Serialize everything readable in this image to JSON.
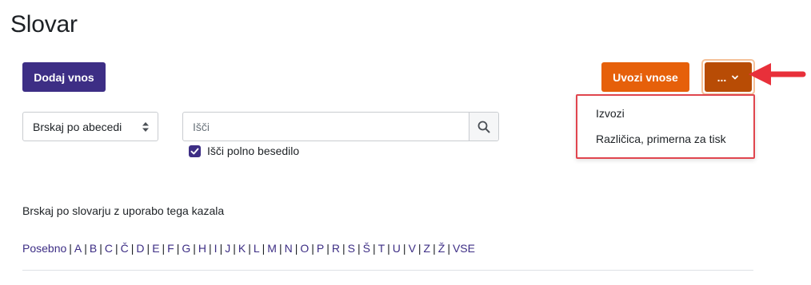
{
  "page": {
    "title": "Slovar"
  },
  "toolbar": {
    "add_label": "Dodaj vnos",
    "import_label": "Uvozi vnose",
    "more_label": "..."
  },
  "more_menu": {
    "items": [
      "Izvozi",
      "Različica, primerna za tisk"
    ]
  },
  "browse_select": {
    "value": "Brskaj po abecedi"
  },
  "search": {
    "placeholder": "Išči",
    "value": ""
  },
  "fulltext": {
    "label": "Išči polno besedilo",
    "checked": true
  },
  "browse": {
    "hint": "Brskaj po slovarju z uporabo tega kazala",
    "letters": [
      "Posebno",
      "A",
      "B",
      "C",
      "Č",
      "D",
      "E",
      "F",
      "G",
      "H",
      "I",
      "J",
      "K",
      "L",
      "M",
      "N",
      "O",
      "P",
      "R",
      "S",
      "Š",
      "T",
      "U",
      "V",
      "Z",
      "Ž",
      "VSE"
    ]
  },
  "colors": {
    "primary": "#3d2e85",
    "import_orange": "#e6600a",
    "more_dark_orange": "#b84c05",
    "highlight_red": "#e0454e",
    "arrow_red": "#e8303a"
  }
}
